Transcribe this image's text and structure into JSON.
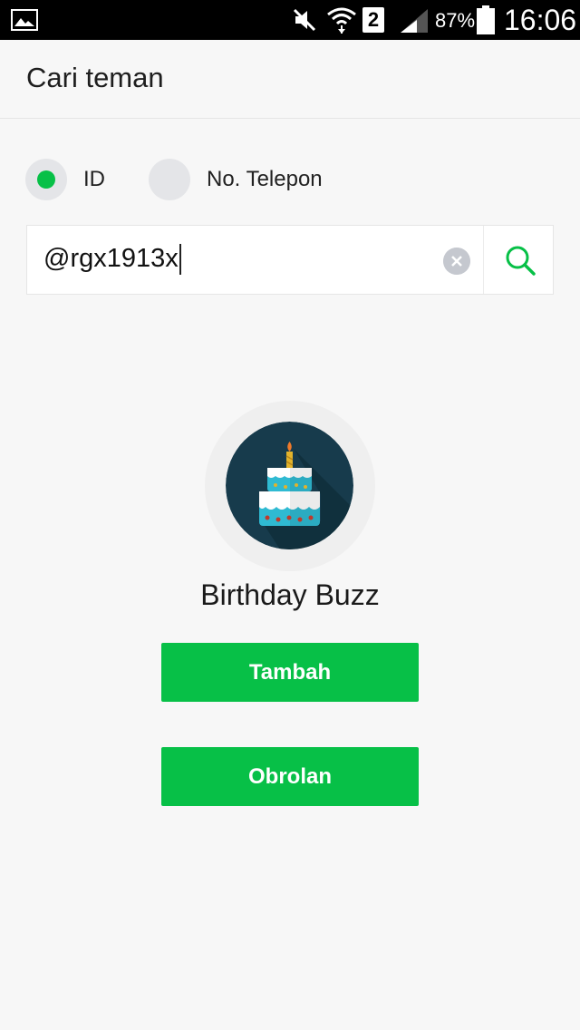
{
  "status_bar": {
    "battery_percent": "87%",
    "time": "16:06",
    "sim_slot": "2"
  },
  "header": {
    "title": "Cari teman"
  },
  "search_type": {
    "options": [
      {
        "label": "ID",
        "selected": true
      },
      {
        "label": "No. Telepon",
        "selected": false
      }
    ]
  },
  "search": {
    "value": "@rgx1913x"
  },
  "profile": {
    "name": "Birthday Buzz",
    "avatar_icon": "birthday-cake-icon"
  },
  "actions": {
    "add_label": "Tambah",
    "chat_label": "Obrolan"
  },
  "colors": {
    "accent": "#07c047",
    "avatar_bg": "#173b4c"
  }
}
